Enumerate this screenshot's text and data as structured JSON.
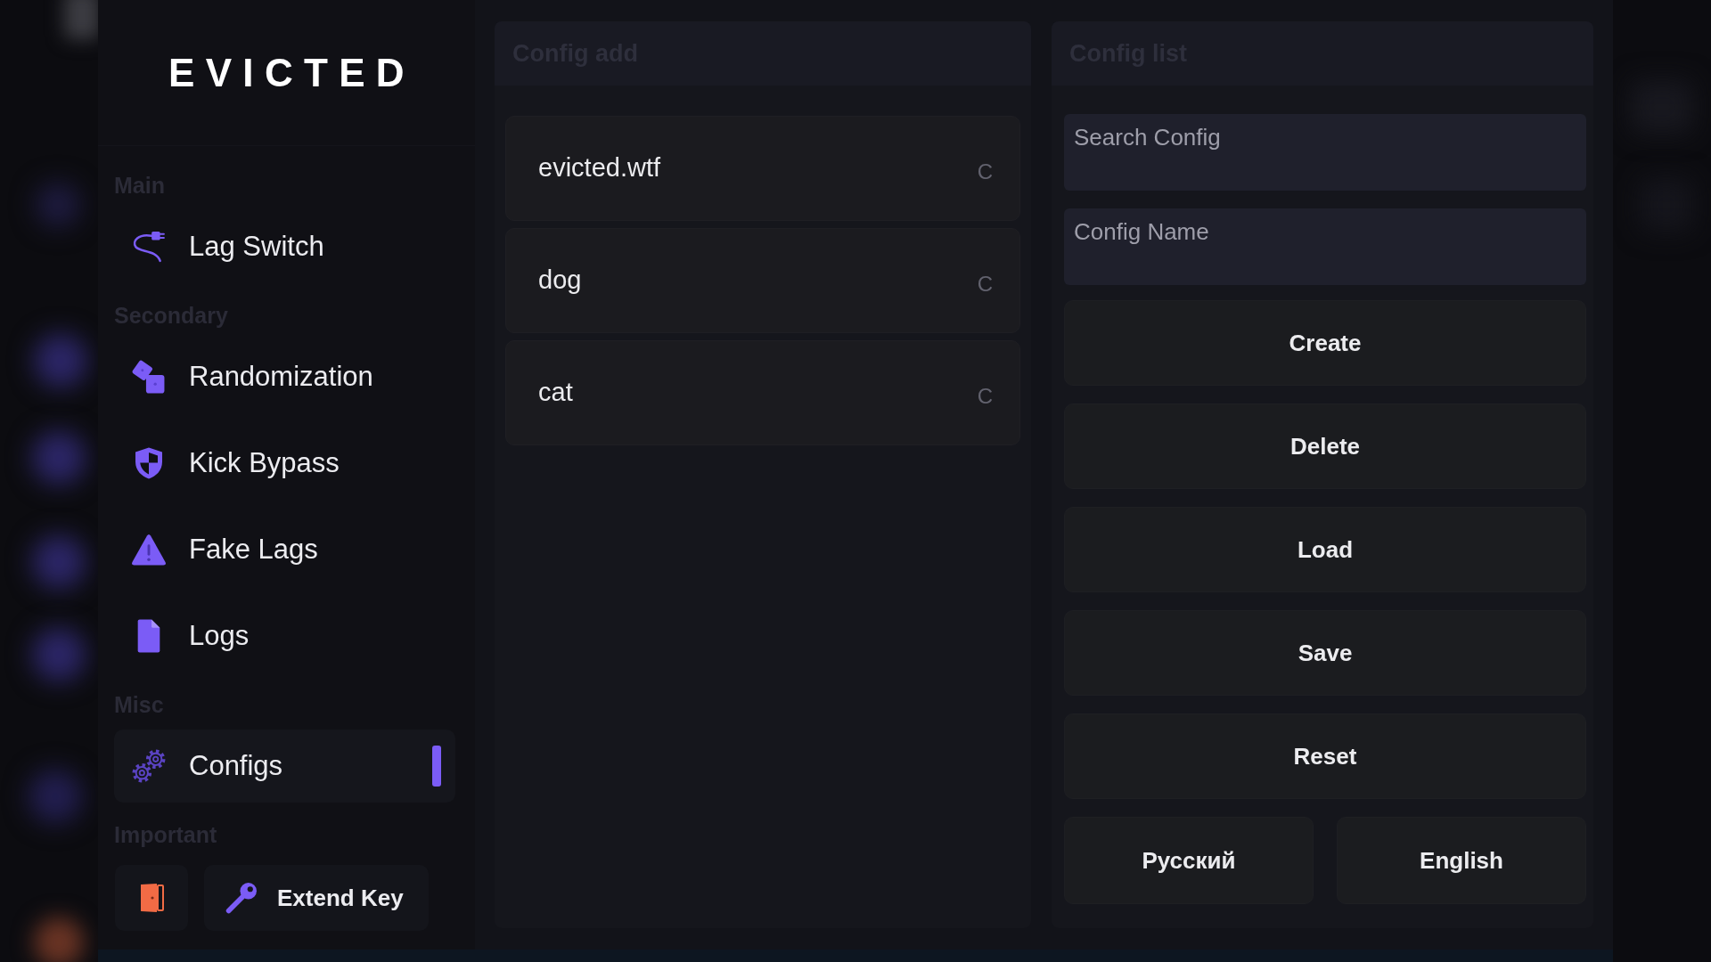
{
  "sidebar": {
    "logo": "EVICTED",
    "sections": [
      {
        "label": "Main",
        "items": [
          {
            "label": "Lag Switch",
            "selected": false
          }
        ]
      },
      {
        "label": "Secondary",
        "items": [
          {
            "label": "Randomization",
            "selected": false
          },
          {
            "label": "Kick Bypass",
            "selected": false
          },
          {
            "label": "Fake Lags",
            "selected": false
          },
          {
            "label": "Logs",
            "selected": false
          }
        ]
      },
      {
        "label": "Misc",
        "items": [
          {
            "label": "Configs",
            "selected": true
          }
        ]
      },
      {
        "label": "Important",
        "buttons": [
          {
            "kind": "icon"
          },
          {
            "kind": "labeled",
            "label": "Extend Key"
          }
        ]
      }
    ]
  },
  "config_add": {
    "title": "Config add",
    "items": [
      {
        "name": "evicted.wtf",
        "suffix": "C"
      },
      {
        "name": "dog",
        "suffix": "C"
      },
      {
        "name": "cat",
        "suffix": "C"
      }
    ]
  },
  "config_list": {
    "title": "Config list",
    "fields": [
      {
        "placeholder": "Search Config"
      },
      {
        "placeholder": "Config Name"
      }
    ],
    "buttons": [
      "Create",
      "Delete",
      "Load",
      "Save",
      "Reset"
    ],
    "languages": [
      "Русский",
      "English"
    ]
  }
}
